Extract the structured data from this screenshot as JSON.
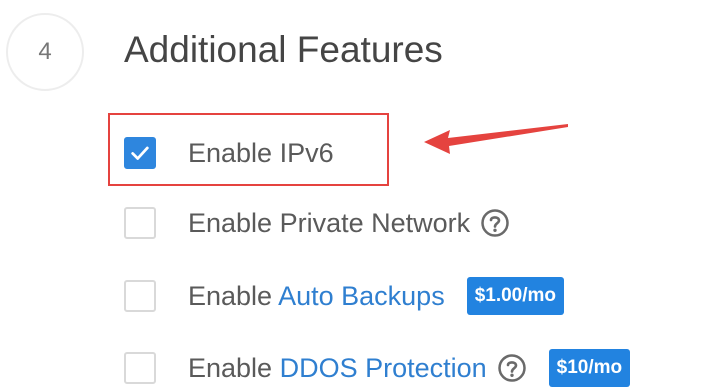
{
  "section": {
    "step_number": "4",
    "title": "Additional Features"
  },
  "options": [
    {
      "prefix": "Enable IPv6",
      "checked": true
    },
    {
      "prefix": "Enable Private Network",
      "checked": false,
      "help_icon": "help-circle-icon"
    },
    {
      "prefix": "Enable ",
      "link": "Auto Backups",
      "badge": "$1.00/mo",
      "checked": false
    },
    {
      "prefix": "Enable ",
      "link": "DDOS Protection",
      "badge": "$10/mo",
      "checked": false,
      "help_icon": "help-circle-icon"
    }
  ],
  "colors": {
    "accent": "#2e86de",
    "link": "#2f7fd0",
    "badge": "#2283e0",
    "annotation": "#e5433f"
  }
}
